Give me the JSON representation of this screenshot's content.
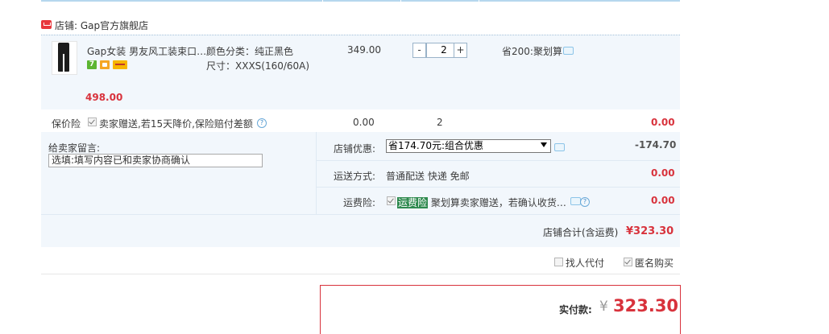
{
  "shop": {
    "label": "店铺:",
    "name": "Gap官方旗舰店"
  },
  "item": {
    "title": "Gap女装 男友风工装束口…",
    "color": "颜色分类：纯正黑色",
    "size": "尺寸：XXXS(160/60A)",
    "price": "349.00",
    "quantity": "2",
    "minus": "-",
    "plus": "+",
    "promo": "省200:聚划算",
    "badge_seven": "7",
    "subtotal": "498.00"
  },
  "insurance": {
    "label": "保价险",
    "desc": "卖家赠送,若15天降价,保险赔付差额",
    "price": "0.00",
    "quantity": "2",
    "subtotal": "0.00"
  },
  "message": {
    "label": "给卖家留言:",
    "placeholder": "选填:填写内容已和卖家协商确认"
  },
  "discount": {
    "label": "店铺优惠:",
    "selected": "省174.70元:组合优惠",
    "amount": "-174.70"
  },
  "shipping": {
    "label": "运送方式:",
    "value": "普通配送 快递 免邮",
    "amount": "0.00"
  },
  "freight_insurance": {
    "label": "运费险:",
    "tag": "运费险",
    "desc": "聚划算卖家赠送，若确认收货…",
    "amount": "0.00"
  },
  "shop_total": {
    "label": "店铺合计(含运费)",
    "value": "¥323.30"
  },
  "options": {
    "proxy_pay": "找人代付",
    "anonymous": "匿名购买"
  },
  "payment": {
    "label": "实付款:",
    "currency": "¥",
    "amount": "323.30"
  }
}
